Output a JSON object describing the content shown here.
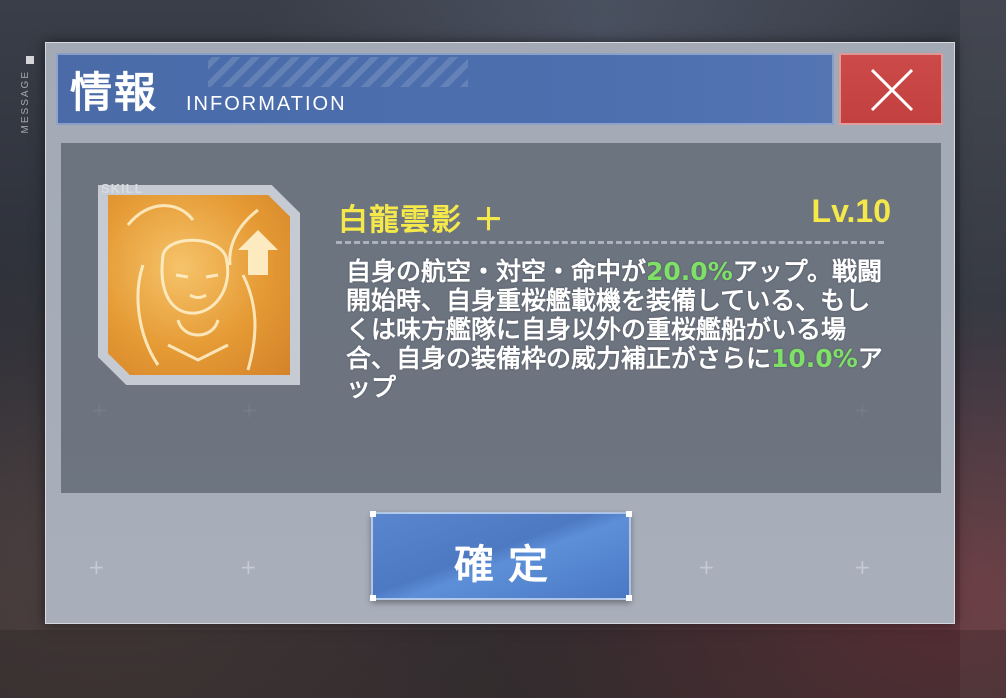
{
  "background": {
    "side_label": "MESSAGE"
  },
  "dialog": {
    "title": "情報",
    "subtitle": "INFORMATION",
    "close_icon": "close-x-icon"
  },
  "skill": {
    "tag": "SKILL",
    "name": "白龍雲影 ＋",
    "level": "Lv.10",
    "description": {
      "line1_a": "自身の航空・対空・命中が",
      "line1_hl": "20.0%",
      "line1_b": "アップ。戦闘開始時、自身重桜艦載機を装備している、もしくは味方艦隊に自身以外の重桜艦船がいる場合、自身の装備枠の威力補正がさらに",
      "line2_hl": "10.0%",
      "line2_b": "アップ"
    }
  },
  "buttons": {
    "confirm_label": "確定"
  },
  "colors": {
    "header_blue": "#4a6ba8",
    "close_red": "#c24040",
    "skill_name_yellow": "#f5e84a",
    "highlight_green": "#7ee066",
    "confirm_blue": "#4d79c2"
  }
}
